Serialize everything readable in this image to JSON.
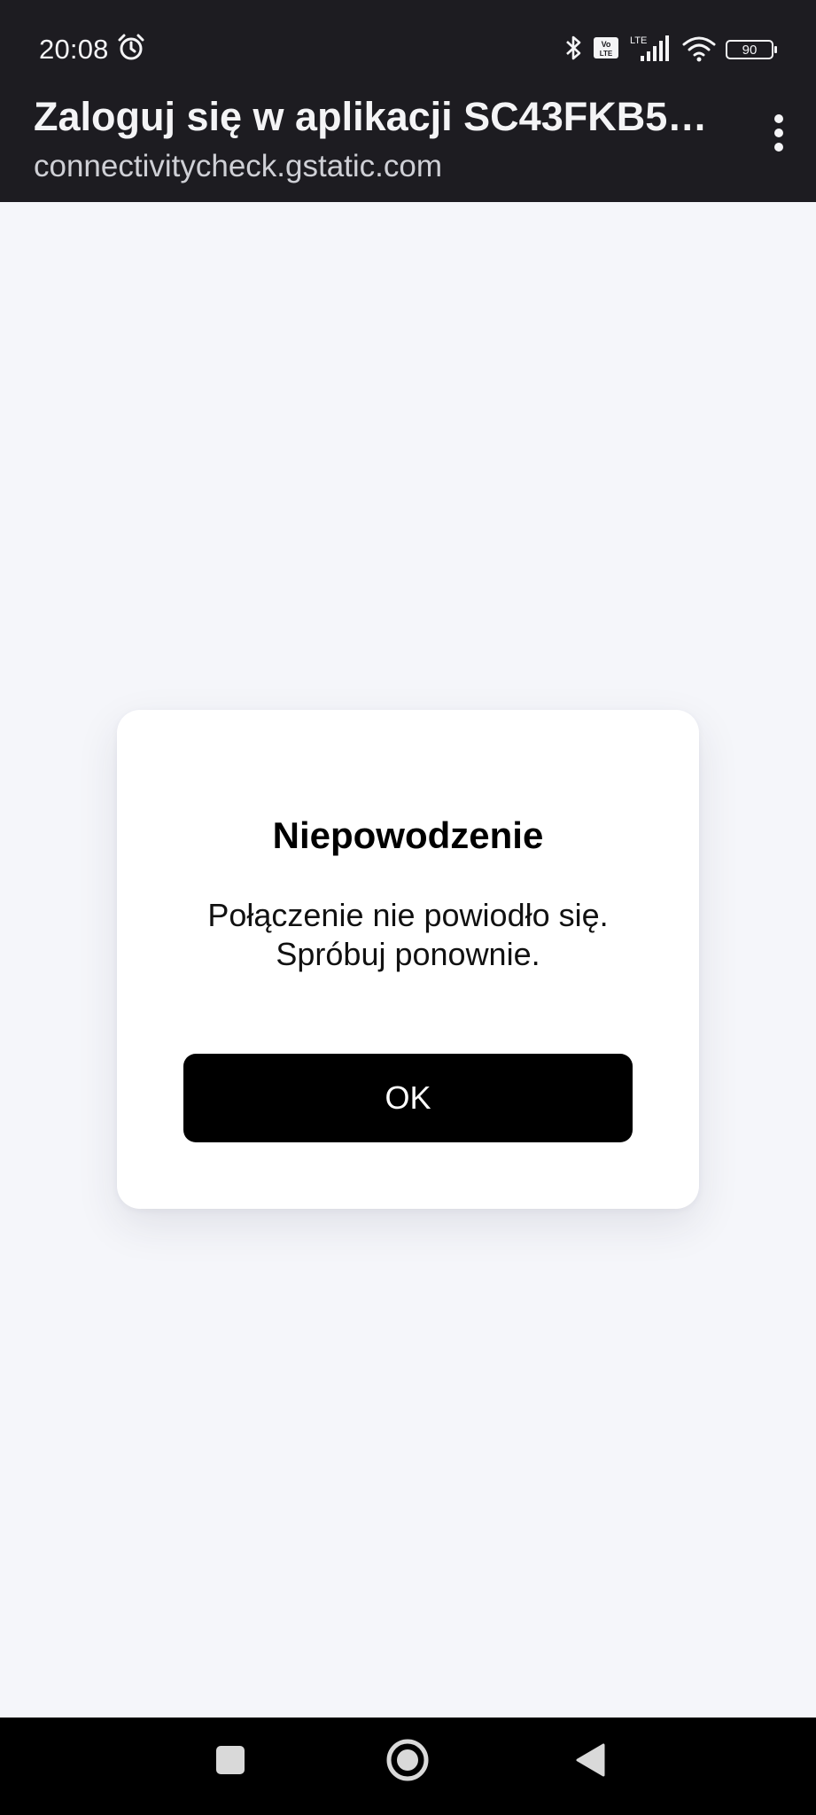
{
  "status_bar": {
    "time": "20:08",
    "battery_level": "90",
    "network_label": "LTE",
    "volte_label": "Vo LTE"
  },
  "header": {
    "title": "Zaloguj się w aplikacji SC43FKB5X…",
    "url": "connectivitycheck.gstatic.com"
  },
  "dialog": {
    "title": "Niepowodzenie",
    "message_line1": "Połączenie nie powiodło się.",
    "message_line2": "Spróbuj ponownie.",
    "ok_label": "OK"
  },
  "colors": {
    "header_bg": "#1d1c21",
    "page_bg": "#f5f6fa",
    "button_bg": "#000000",
    "nav_bg": "#000000"
  },
  "icons": {
    "status_left": [
      "alarm-icon"
    ],
    "status_right": [
      "bluetooth-icon",
      "volte-icon",
      "lte-signal-icon",
      "wifi-icon",
      "battery-icon"
    ],
    "header": [
      "more-vertical-icon"
    ],
    "navigation": [
      "recents-icon",
      "home-icon",
      "back-icon"
    ]
  }
}
